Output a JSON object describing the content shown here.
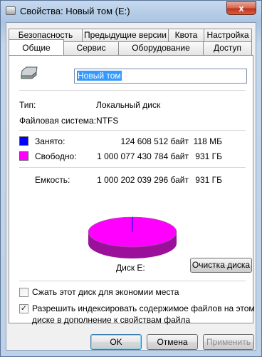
{
  "window": {
    "title": "Свойства: Новый том (E:)",
    "close_label": "x"
  },
  "tabs": {
    "row1": [
      "Безопасность",
      "Предыдущие версии",
      "Квота",
      "Настройка"
    ],
    "row2": [
      "Общие",
      "Сервис",
      "Оборудование",
      "Доступ"
    ],
    "active": "Общие"
  },
  "general": {
    "volume_name": "Новый том",
    "type_label": "Тип:",
    "type_value": "Локальный диск",
    "fs_label": "Файловая система:",
    "fs_value": "NTFS",
    "used_label": "Занято:",
    "used_bytes": "124 608 512 байт",
    "used_short": "118 МБ",
    "free_label": "Свободно:",
    "free_bytes": "1 000 077 430 784 байт",
    "free_short": "931 ГБ",
    "capacity_label": "Емкость:",
    "capacity_bytes": "1 000 202 039 296 байт",
    "capacity_short": "931 ГБ",
    "disk_label": "Диск E:",
    "cleanup_button": "Очистка диска",
    "compress_label": "Сжать этот диск для экономии места",
    "compress_checked": false,
    "index_label_line1": "Разрешить индексировать содержимое файлов на этом",
    "index_label_line2": "диске в дополнение к свойствам файла",
    "index_checked": true
  },
  "usage": {
    "used_fraction": 0.0001,
    "used_color": "#0000ff",
    "free_color": "#ff00ff"
  },
  "footer": {
    "ok": "OK",
    "cancel": "Отмена",
    "apply": "Применить"
  }
}
